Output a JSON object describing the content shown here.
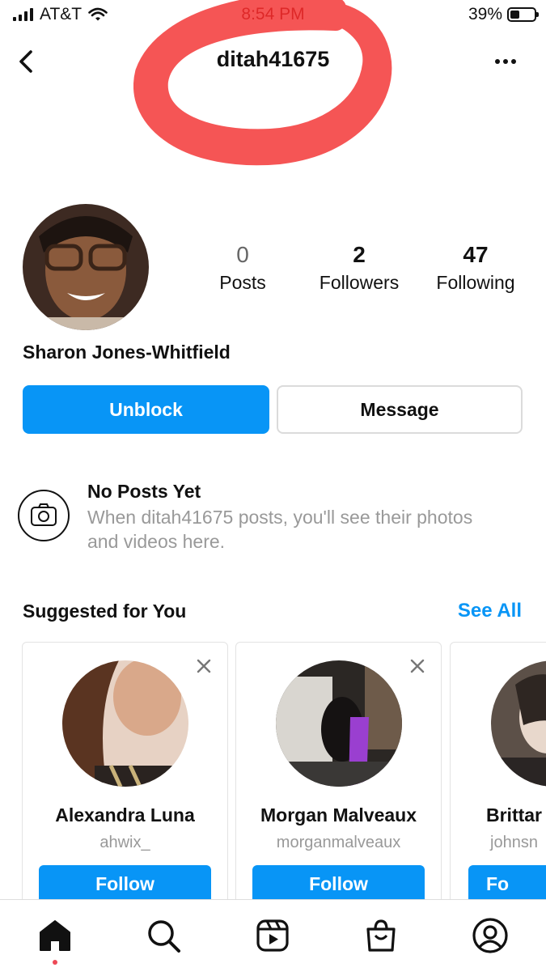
{
  "status_bar": {
    "carrier": "AT&T",
    "time": "8:54 PM",
    "battery_text": "39%",
    "battery_level": 0.39
  },
  "header": {
    "username": "ditah41675",
    "back_icon": "chevron-left-icon",
    "more_icon": "more-horizontal-icon"
  },
  "profile": {
    "full_name": "Sharon Jones-Whitfield",
    "stats": [
      {
        "value": "0",
        "label": "Posts"
      },
      {
        "value": "2",
        "label": "Followers"
      },
      {
        "value": "47",
        "label": "Following"
      }
    ]
  },
  "actions": {
    "unblock_label": "Unblock",
    "message_label": "Message"
  },
  "no_posts": {
    "title": "No Posts Yet",
    "description": "When ditah41675 posts, you'll see their photos and videos here."
  },
  "suggestions": {
    "title": "Suggested for You",
    "see_all_label": "See All",
    "cards": [
      {
        "name": "Alexandra Luna",
        "username": "ahwix_",
        "follow_label": "Follow"
      },
      {
        "name": "Morgan Malveaux",
        "username": "morganmalveaux",
        "follow_label": "Follow"
      },
      {
        "name": "Brittar",
        "username": "johnsn",
        "follow_label": "Fo"
      }
    ]
  },
  "bottom_nav": {
    "items": [
      "home-icon",
      "search-icon",
      "reels-icon",
      "shop-icon",
      "profile-icon"
    ]
  },
  "colors": {
    "accent": "#0895f6",
    "annotation": "#f22a2a"
  }
}
